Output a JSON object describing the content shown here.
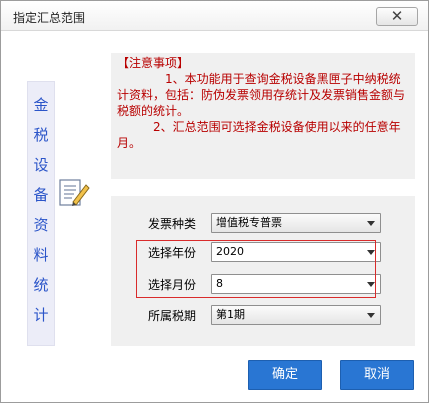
{
  "window": {
    "title": "指定汇总范围",
    "close_glyph": "✕"
  },
  "side_panel": {
    "chars": [
      "金",
      "税",
      "设",
      "备",
      "资",
      "料",
      "统",
      "计"
    ]
  },
  "notice": {
    "heading": "【注意事项】",
    "line1": "1、本功能用于查询金税设备黑匣子中纳税统计资料，包括：防伪发票领用存统计及发票销售金额与税额的统计。",
    "line2": "2、汇总范围可选择金税设备使用以来的任意年月。"
  },
  "form": {
    "invoice_type": {
      "label": "发票种类",
      "value": "增值税专普票"
    },
    "year": {
      "label": "选择年份",
      "value": "2020"
    },
    "month": {
      "label": "选择月份",
      "value": "8"
    },
    "period": {
      "label": "所属税期",
      "value": "第1期"
    }
  },
  "buttons": {
    "ok": "确定",
    "cancel": "取消"
  },
  "colors": {
    "accent_blue": "#2976d3",
    "notice_red": "#b80000",
    "side_text_blue": "#2b55c9",
    "highlight_red": "#d92b2b"
  },
  "icons": {
    "doc": "document-edit-icon"
  }
}
